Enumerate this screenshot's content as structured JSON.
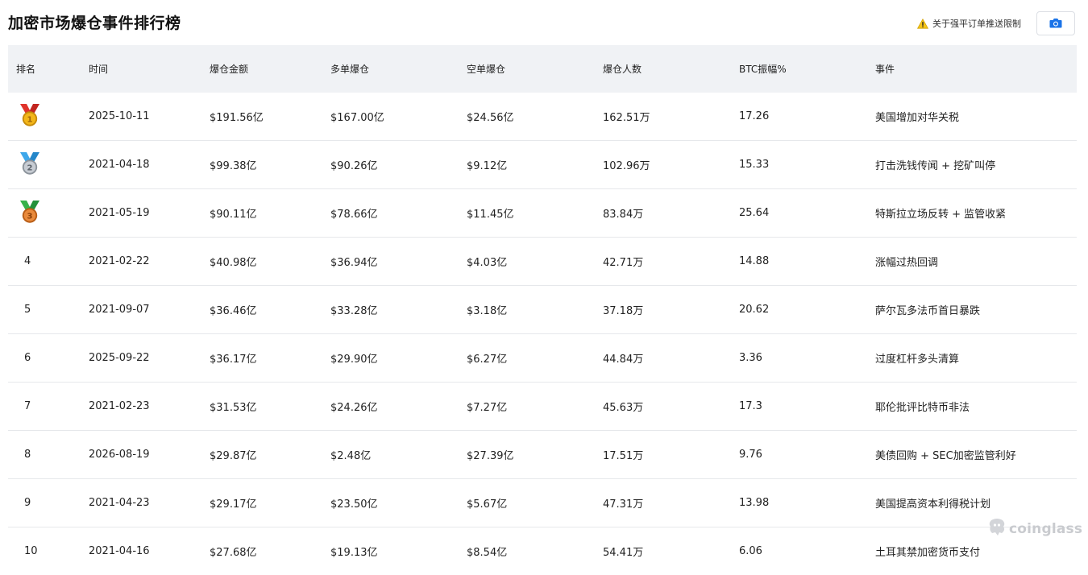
{
  "title": "加密市场爆仓事件排行榜",
  "notice": {
    "label": "关于强平订单推送限制",
    "icon": "warning-icon"
  },
  "screenshot_button": {
    "icon": "camera-icon"
  },
  "accent_color": "#1a73e8",
  "columns": [
    "排名",
    "时间",
    "爆仓金额",
    "多单爆仓",
    "空单爆仓",
    "爆仓人数",
    "BTC振幅%",
    "事件"
  ],
  "rows": [
    {
      "rank": "1",
      "medal": "gold",
      "date": "2025-10-11",
      "total": "$191.56亿",
      "long": "$167.00亿",
      "short": "$24.56亿",
      "people": "162.51万",
      "amplitude": "17.26",
      "event": "美国增加对华关税"
    },
    {
      "rank": "2",
      "medal": "silver",
      "date": "2021-04-18",
      "total": "$99.38亿",
      "long": "$90.26亿",
      "short": "$9.12亿",
      "people": "102.96万",
      "amplitude": "15.33",
      "event": "打击洗钱传闻 + 挖矿叫停"
    },
    {
      "rank": "3",
      "medal": "bronze",
      "date": "2021-05-19",
      "total": "$90.11亿",
      "long": "$78.66亿",
      "short": "$11.45亿",
      "people": "83.84万",
      "amplitude": "25.64",
      "event": "特斯拉立场反转 + 监管收紧"
    },
    {
      "rank": "4",
      "date": "2021-02-22",
      "total": "$40.98亿",
      "long": "$36.94亿",
      "short": "$4.03亿",
      "people": "42.71万",
      "amplitude": "14.88",
      "event": "涨幅过热回调"
    },
    {
      "rank": "5",
      "date": "2021-09-07",
      "total": "$36.46亿",
      "long": "$33.28亿",
      "short": "$3.18亿",
      "people": "37.18万",
      "amplitude": "20.62",
      "event": "萨尔瓦多法币首日暴跌"
    },
    {
      "rank": "6",
      "date": "2025-09-22",
      "total": "$36.17亿",
      "long": "$29.90亿",
      "short": "$6.27亿",
      "people": "44.84万",
      "amplitude": "3.36",
      "event": "过度杠杆多头清算"
    },
    {
      "rank": "7",
      "date": "2021-02-23",
      "total": "$31.53亿",
      "long": "$24.26亿",
      "short": "$7.27亿",
      "people": "45.63万",
      "amplitude": "17.3",
      "event": "耶伦批评比特币非法"
    },
    {
      "rank": "8",
      "date": "2026-08-19",
      "total": "$29.87亿",
      "long": "$2.48亿",
      "short": "$27.39亿",
      "people": "17.51万",
      "amplitude": "9.76",
      "event": "美债回购 + SEC加密监管利好"
    },
    {
      "rank": "9",
      "date": "2021-04-23",
      "total": "$29.17亿",
      "long": "$23.50亿",
      "short": "$5.67亿",
      "people": "47.31万",
      "amplitude": "13.98",
      "event": "美国提高资本利得税计划"
    },
    {
      "rank": "10",
      "date": "2021-04-16",
      "total": "$27.68亿",
      "long": "$19.13亿",
      "short": "$8.54亿",
      "people": "54.41万",
      "amplitude": "6.06",
      "event": "土耳其禁加密货币支付"
    }
  ],
  "watermark": "coinglass"
}
